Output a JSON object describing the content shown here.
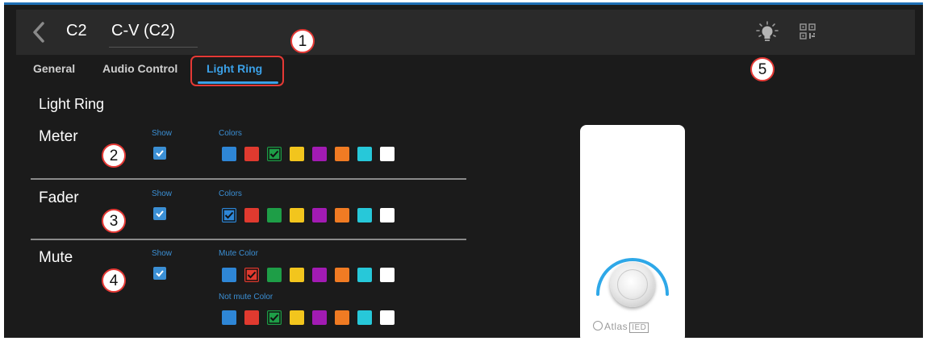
{
  "header": {
    "device_id": "C2",
    "device_name": "C-V (C2)"
  },
  "icons": {
    "back": "chevron-left-icon",
    "identify": "lightbulb-icon",
    "qr": "qr-code-icon"
  },
  "tabs": [
    {
      "label": "General",
      "active": false
    },
    {
      "label": "Audio Control",
      "active": false
    },
    {
      "label": "Light Ring",
      "active": true
    }
  ],
  "section_title": "Light Ring",
  "palette": [
    "#2e86d6",
    "#e03a2f",
    "#1e9e47",
    "#f2c51d",
    "#a21bb3",
    "#f07b23",
    "#27c8d9",
    "#ffffff"
  ],
  "rows": {
    "meter": {
      "label": "Meter",
      "show_label": "Show",
      "show": true,
      "colors_label": "Colors",
      "selected_index": 2
    },
    "fader": {
      "label": "Fader",
      "show_label": "Show",
      "show": true,
      "colors_label": "Colors",
      "selected_index": 0
    },
    "mute": {
      "label": "Mute",
      "show_label": "Show",
      "show": true,
      "mute_color_label": "Mute Color",
      "mute_selected_index": 1,
      "not_mute_color_label": "Not mute Color",
      "not_mute_selected_index": 2
    }
  },
  "callouts": [
    "1",
    "2",
    "3",
    "4",
    "5"
  ],
  "device_preview": {
    "ring_color": "#2ea8e8",
    "brand": "Atlas",
    "brand_box": "IED"
  },
  "colors": {
    "accent": "#3ba1e8",
    "callout": "#e53935",
    "background": "#1b1b1b"
  }
}
